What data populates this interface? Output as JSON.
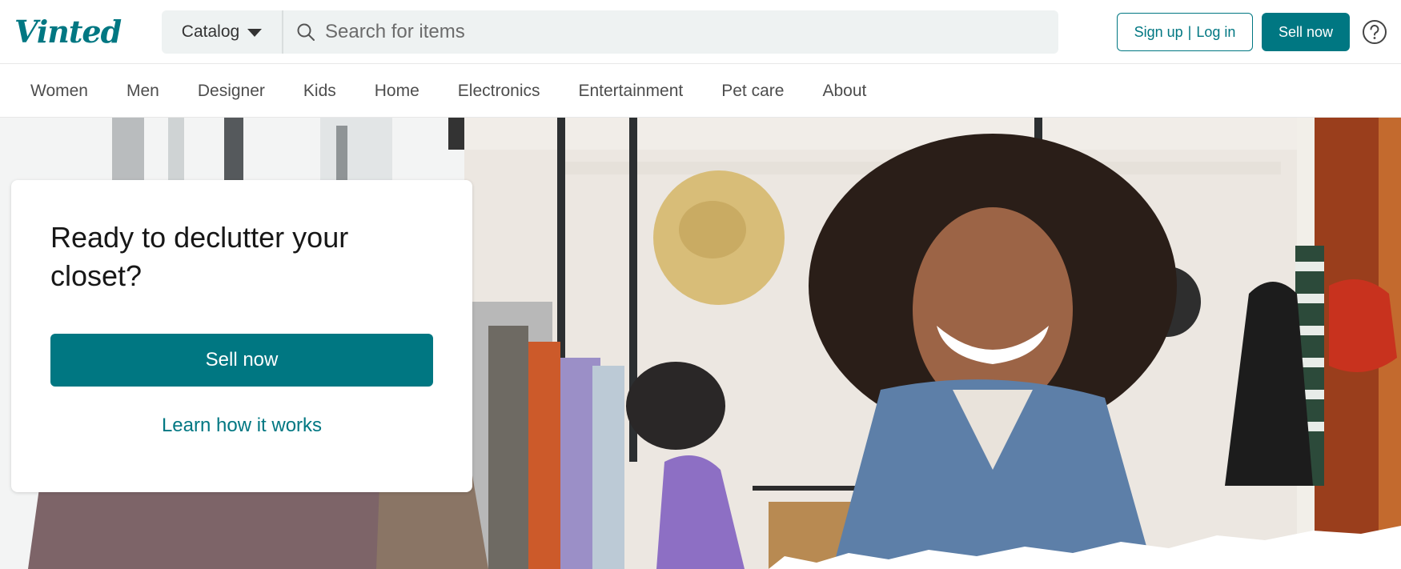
{
  "brand": {
    "name": "Vinted",
    "color": "#007782"
  },
  "header": {
    "catalog_label": "Catalog",
    "search_placeholder": "Search for items",
    "auth": {
      "signup": "Sign up",
      "separator": "|",
      "login": "Log in"
    },
    "sell_label": "Sell now",
    "help_icon": "question-circle-icon"
  },
  "nav": {
    "items": [
      {
        "label": "Women"
      },
      {
        "label": "Men"
      },
      {
        "label": "Designer"
      },
      {
        "label": "Kids"
      },
      {
        "label": "Home"
      },
      {
        "label": "Electronics"
      },
      {
        "label": "Entertainment"
      },
      {
        "label": "Pet care"
      },
      {
        "label": "About"
      }
    ]
  },
  "hero": {
    "title": "Ready to declutter your closet?",
    "sell_label": "Sell now",
    "learn_label": "Learn how it works"
  }
}
